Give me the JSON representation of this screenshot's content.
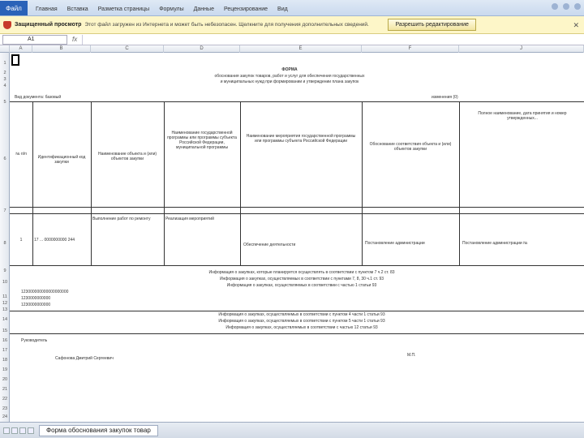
{
  "ribbon": {
    "file_tab": "Файл",
    "tabs": [
      "Главная",
      "Вставка",
      "Разметка страницы",
      "Формулы",
      "Данные",
      "Рецензирование",
      "Вид"
    ]
  },
  "protected_view": {
    "title": "Защищенный просмотр",
    "message": "Этот файл загружен из Интернета и может быть небезопасен. Щелкните для получения дополнительных сведений.",
    "button": "Разрешить редактирование"
  },
  "formula_bar": {
    "cell_ref": "A1",
    "fx": "fx"
  },
  "columns": [
    "A",
    "B",
    "C",
    "D",
    "E",
    "F",
    "G",
    "H",
    "I",
    "J"
  ],
  "rows": [
    "1",
    "2",
    "3",
    "4",
    "5",
    "6",
    "7",
    "8",
    "9",
    "10",
    "11",
    "12",
    "13",
    "14",
    "15",
    "16",
    "17",
    "18",
    "19",
    "20",
    "21",
    "22",
    "23",
    "24"
  ],
  "sheet": {
    "title_lines": [
      "ФОРМА",
      "обоснования закупок товаров, работ и услуг для обеспечения государственных",
      "и муниципальных нужд при формировании и утверждении плана закупок"
    ],
    "org_label": "Вид документа: базовый",
    "change_label": "изменения (0)",
    "headers": [
      "№ п/п",
      "Идентификационный код закупки",
      "Наименование объекта и (или) объектов закупки",
      "Наименование государственной программы или программы субъекта Российской Федерации, муниципальной программы",
      "Наименование мероприятия государственной программы или программы субъекта Российской Федерации",
      "Обоснование соответствия объекта и (или) объектов закупки",
      "Полное наименование, дата принятия и номер утвержденных..."
    ],
    "row1": {
      "num": "1",
      "code": "17 ... 0000000000 244",
      "object": "Выполнение работ по ремонту",
      "program": "Реализация мероприятий",
      "measure": "Обеспечение деятельности",
      "basis": "Постановление администрации",
      "status": "Постановление администрации №"
    },
    "info_lines": [
      "Информация о закупках, которые планируется осуществлять в соответствии с пунктом 7 ч.2 ст. 83",
      "Информация о закупках, осуществляемых в соответствии с пунктами 7, 8, 30 ч.1 ст. 93",
      "Информация о закупках, осуществляемых в соответствии с частью 1 статьи 93"
    ],
    "info_lines2": [
      "Информация о закупках, осуществляемых в соответствии с пунктом 4 части 1 статьи 93",
      "Информация о закупках, осуществляемых в соответствии с пунктом 5 части 1 статьи 93",
      "Информация о закупках, осуществляемых в соответствии с частью 12 статьи 93"
    ],
    "codes": [
      "123000000000000000000",
      "1230000000000",
      "1230000000000"
    ],
    "sign_label": "Руководитель",
    "signer": "Сафонова Дмитрий Сергеевич",
    "mp": "М.П."
  },
  "sheet_tab": "Форма обоснования закупок товар"
}
